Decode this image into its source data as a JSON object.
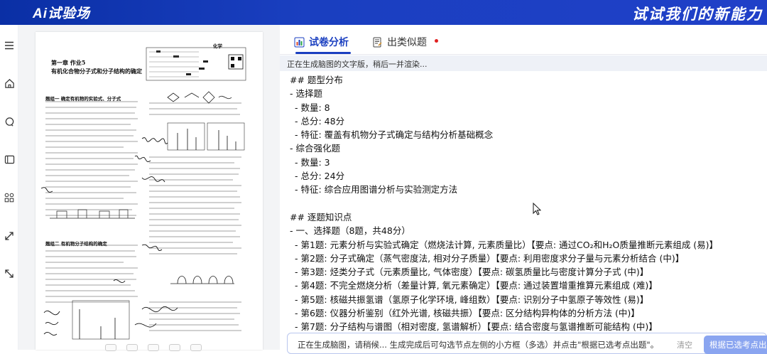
{
  "header": {
    "logo": "Ai试验场",
    "slogan": "试试我们的新能力"
  },
  "rail": {
    "icons": [
      "menu-icon",
      "home-icon",
      "chat-icon",
      "book-icon",
      "apps-icon",
      "expand-icon",
      "collapse-icon"
    ]
  },
  "paper": {
    "chapter": "第一章  作业5",
    "title": "有机化合物分子式和分子结构的确定",
    "subject": "化学",
    "section1": "题组一  确定有机物的实验式、分子式",
    "section2": "题组二  有机物分子结构的确定"
  },
  "tabs": {
    "active": "试卷分析",
    "inactive": "出类似题"
  },
  "status": "正在生成脑图的文字版，稍后一并渲染...",
  "content": [
    "## 题型分布",
    "- 选择题",
    "  - 数量: 8",
    "  - 总分: 48分",
    "  - 特征: 覆盖有机物分子式确定与结构分析基础概念",
    "- 综合强化题",
    "  - 数量: 3",
    "  - 总分: 24分",
    "  - 特征: 综合应用图谱分析与实验测定方法",
    "",
    "## 逐题知识点",
    "- 一、选择题（8题，共48分）",
    "  - 第1题: 元素分析与实验式确定（燃烧法计算, 元素质量比）【要点: 通过CO₂和H₂O质量推断元素组成 (易)】",
    "  - 第2题: 分子式确定（蒸气密度法, 相对分子质量）【要点: 利用密度求分子量与元素分析结合 (中)】",
    "  - 第3题: 烃类分子式（元素质量比, 气体密度）【要点: 碳氢质量比与密度计算分子式 (中)】",
    "  - 第4题: 不完全燃烧分析（差量计算, 氧元素确定）【要点: 通过装置增重推算元素组成 (难)】",
    "  - 第5题: 核磁共振氢谱（氢原子化学环境, 峰组数）【要点: 识别分子中氢原子等效性 (易)】",
    "  - 第6题: 仪器分析鉴别（红外光谱, 核磁共振）【要点: 区分结构异构体的分析方法 (中)】",
    "  - 第7题: 分子结构与谱图（相对密度, 氢谱解析）【要点: 结合密度与氢谱推断可能结构 (中)】"
  ],
  "input": {
    "text": "正在生成脑图，请稍候... 生成完成后可勾选节点左侧的小方框（多选）并点击\"根据已选考点出题\"。",
    "clear": "清空",
    "generate": "根据已选考点出题"
  },
  "colors": {
    "brand": "#1a3fc0",
    "status_bg": "#eef1f7",
    "red_dot": "#e02020"
  }
}
